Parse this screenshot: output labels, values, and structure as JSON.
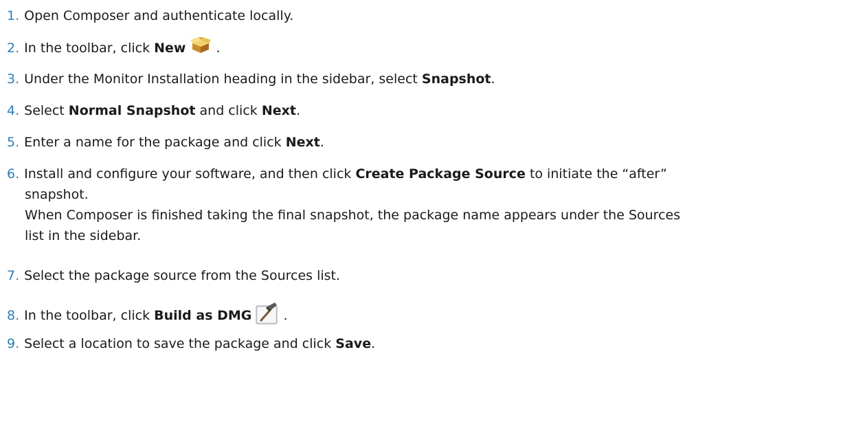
{
  "steps": [
    {
      "num": "1.",
      "text": "Open Composer and authenticate locally."
    },
    {
      "num": "2.",
      "pre": "In the toolbar, click ",
      "b1": "New",
      "post": " .",
      "icon": "package-box-icon"
    },
    {
      "num": "3.",
      "pre": "Under the Monitor Installation heading in the sidebar, select ",
      "b1": "Snapshot",
      "post": "."
    },
    {
      "num": "4.",
      "pre": "Select ",
      "b1": "Normal Snapshot",
      "mid": " and click ",
      "b2": "Next",
      "post": "."
    },
    {
      "num": "5.",
      "pre": "Enter a name for the package and click ",
      "b1": "Next",
      "post": "."
    },
    {
      "num": "6.",
      "pre": "Install and configure your software, and then click ",
      "b1": "Create Package Source",
      "post": " to initiate the “after”",
      "line2": "snapshot.",
      "line3": "When Composer is finished taking the final snapshot, the package name appears under the Sources",
      "line4": "list in the sidebar."
    },
    {
      "num": "7.",
      "text": "Select the package source from the Sources list."
    },
    {
      "num": "8.",
      "pre": "In the toolbar, click ",
      "b1": "Build as DMG",
      "post": " .",
      "icon": "build-hammer-icon"
    },
    {
      "num": "9.",
      "pre": "Select a location to save the package and click ",
      "b1": "Save",
      "post": "."
    }
  ]
}
